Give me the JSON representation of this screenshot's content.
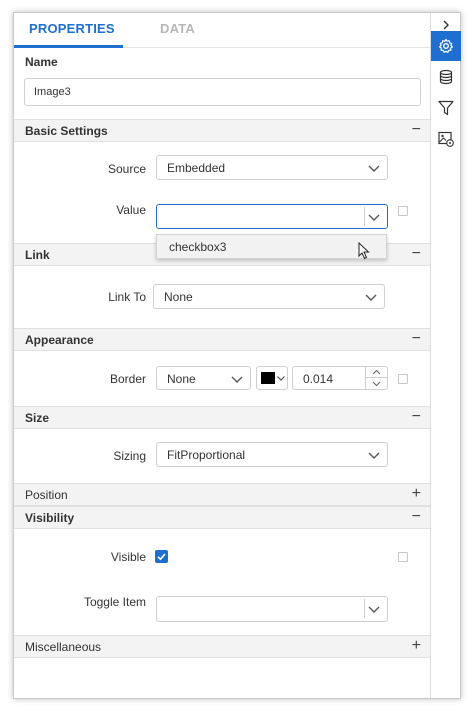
{
  "tabs": {
    "properties": "PROPERTIES",
    "data": "DATA"
  },
  "name": {
    "label": "Name",
    "value": "Image3"
  },
  "sections": {
    "basic": {
      "title": "Basic Settings",
      "toggle": "−"
    },
    "link": {
      "title": "Link",
      "toggle": "−"
    },
    "appearance": {
      "title": "Appearance",
      "toggle": "−"
    },
    "size": {
      "title": "Size",
      "toggle": "−"
    },
    "position": {
      "title": "Position",
      "toggle": "+"
    },
    "visibility": {
      "title": "Visibility",
      "toggle": "−"
    },
    "misc": {
      "title": "Miscellaneous",
      "toggle": "+"
    }
  },
  "basic": {
    "source_label": "Source",
    "source_value": "Embedded",
    "value_label": "Value",
    "value_value": "",
    "value_popup_option": "checkbox3"
  },
  "link": {
    "linkto_label": "Link To",
    "linkto_value": "None"
  },
  "appearance": {
    "border_label": "Border",
    "border_value": "None",
    "border_color": "#000000",
    "border_width": "0.014"
  },
  "size": {
    "sizing_label": "Sizing",
    "sizing_value": "FitProportional"
  },
  "visibility": {
    "visible_label": "Visible",
    "visible_checked": true,
    "toggle_item_label": "Toggle Item",
    "toggle_item_value": ""
  },
  "rail": {
    "collapse_icon": "chevron-right-icon",
    "items": [
      "gear-icon",
      "database-icon",
      "filter-icon",
      "image-settings-icon"
    ]
  },
  "colors": {
    "accent": "#1f6fd1",
    "section_bg": "#f3f3f3"
  }
}
